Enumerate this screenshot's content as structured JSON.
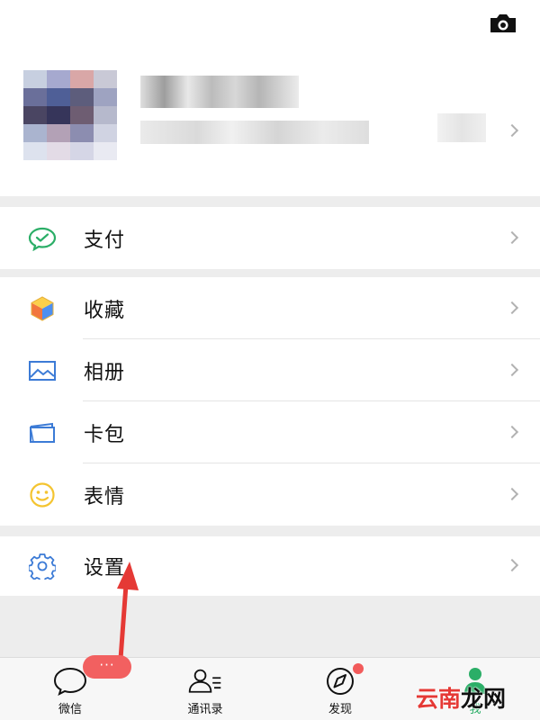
{
  "profile": {
    "camera_icon": "camera-icon",
    "chevron_icon": "chevron-right-icon"
  },
  "menu": {
    "pay": {
      "label": "支付",
      "icon": "wechat-pay-icon",
      "color": "#2bae67"
    },
    "favorites": {
      "label": "收藏",
      "icon": "cube-icon",
      "color": "#f3b23b"
    },
    "album": {
      "label": "相册",
      "icon": "image-icon",
      "color": "#3c7bd6"
    },
    "cards": {
      "label": "卡包",
      "icon": "wallet-icon",
      "color": "#3c7bd6"
    },
    "stickers": {
      "label": "表情",
      "icon": "smiley-icon",
      "color": "#f4c430"
    },
    "settings": {
      "label": "设置",
      "icon": "gear-icon",
      "color": "#3c7bd6"
    }
  },
  "tabbar": {
    "chats": {
      "label": "微信",
      "icon": "chat-bubble-icon"
    },
    "contacts": {
      "label": "通讯录",
      "icon": "contacts-icon"
    },
    "discover": {
      "label": "发现",
      "icon": "compass-icon",
      "has_badge": true
    },
    "me": {
      "label": "我",
      "icon": "person-icon",
      "active_color": "#2bae67"
    }
  },
  "overlay": {
    "menu_pill_text": "···",
    "watermark": {
      "part1": "云南",
      "part2": "龙网"
    },
    "annotation_arrow_color": "#e53935"
  }
}
